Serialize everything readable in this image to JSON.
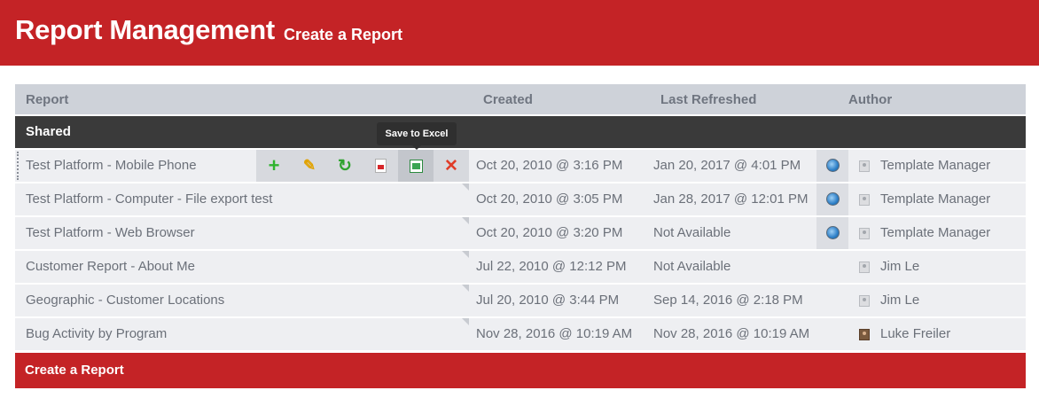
{
  "header": {
    "title": "Report Management",
    "subtitle": "Create a Report"
  },
  "columns": {
    "report": "Report",
    "created": "Created",
    "last_refreshed": "Last Refreshed",
    "author": "Author"
  },
  "group": {
    "label": "Shared"
  },
  "tooltip": "Save to Excel",
  "actions": {
    "add": "+",
    "edit": "✎",
    "refresh": "↻",
    "delete": "✕",
    "icons": [
      "add-icon",
      "pencil-icon",
      "refresh-icon",
      "pdf-icon",
      "excel-icon",
      "delete-icon"
    ]
  },
  "rows": [
    {
      "name": "Test Platform - Mobile Phone",
      "created": "Oct 20, 2010 @ 3:16 PM",
      "refreshed": "Jan 20, 2017 @ 4:01 PM",
      "author": "Template Manager"
    },
    {
      "name": "Test Platform - Computer - File export test",
      "created": "Oct 20, 2010 @ 3:05 PM",
      "refreshed": "Jan 28, 2017 @ 12:01 PM",
      "author": "Template Manager"
    },
    {
      "name": "Test Platform - Web Browser",
      "created": "Oct 20, 2010 @ 3:20 PM",
      "refreshed": "Not Available",
      "author": "Template Manager"
    },
    {
      "name": "Customer Report - About Me",
      "created": "Jul 22, 2010 @ 12:12 PM",
      "refreshed": "Not Available",
      "author": "Jim Le"
    },
    {
      "name": "Geographic - Customer Locations",
      "created": "Jul 20, 2010 @ 3:44 PM",
      "refreshed": "Sep 14, 2016 @ 2:18 PM",
      "author": "Jim Le"
    },
    {
      "name": "Bug Activity by Program",
      "created": "Nov 28, 2016 @ 10:19 AM",
      "refreshed": "Nov 28, 2016 @ 10:19 AM",
      "author": "Luke Freiler"
    }
  ],
  "footer": {
    "label": "Create a Report"
  },
  "colors": {
    "brand": "#c42326",
    "group_bg": "#3a3a3a",
    "header_bg": "#ced2d9",
    "row_bg": "#eeeff2"
  }
}
